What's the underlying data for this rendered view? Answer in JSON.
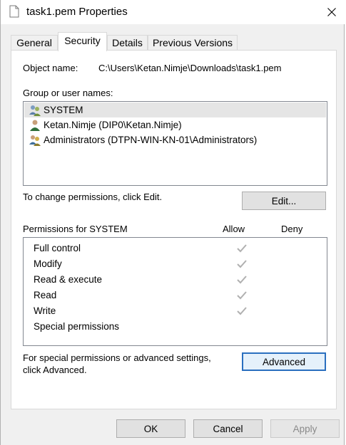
{
  "window": {
    "title": "task1.pem Properties"
  },
  "tabs": [
    {
      "label": "General",
      "active": false
    },
    {
      "label": "Security",
      "active": true
    },
    {
      "label": "Details",
      "active": false
    },
    {
      "label": "Previous Versions",
      "active": false
    }
  ],
  "security": {
    "object_name_label": "Object name:",
    "object_name_value": "C:\\Users\\Ketan.Nimje\\Downloads\\task1.pem",
    "group_label": "Group or user names:",
    "users": [
      {
        "name": "SYSTEM",
        "selected": true
      },
      {
        "name": "Ketan.Nimje (DIP0\\Ketan.Nimje)",
        "selected": false
      },
      {
        "name": "Administrators (DTPN-WIN-KN-01\\Administrators)",
        "selected": false
      }
    ],
    "change_hint": "To change permissions, click Edit.",
    "edit_button": "Edit...",
    "permissions_label": "Permissions for SYSTEM",
    "allow_header": "Allow",
    "deny_header": "Deny",
    "permissions": [
      {
        "name": "Full control",
        "allow": true,
        "deny": false
      },
      {
        "name": "Modify",
        "allow": true,
        "deny": false
      },
      {
        "name": "Read & execute",
        "allow": true,
        "deny": false
      },
      {
        "name": "Read",
        "allow": true,
        "deny": false
      },
      {
        "name": "Write",
        "allow": true,
        "deny": false
      },
      {
        "name": "Special permissions",
        "allow": false,
        "deny": false
      }
    ],
    "advanced_hint_line1": "For special permissions or advanced settings,",
    "advanced_hint_line2": "click Advanced.",
    "advanced_button": "Advanced"
  },
  "footer": {
    "ok": "OK",
    "cancel": "Cancel",
    "apply": "Apply"
  },
  "colors": {
    "accent_focus": "#2a6fbf",
    "selection": "#e5e5e5",
    "check_gray": "#b0b0b0"
  }
}
